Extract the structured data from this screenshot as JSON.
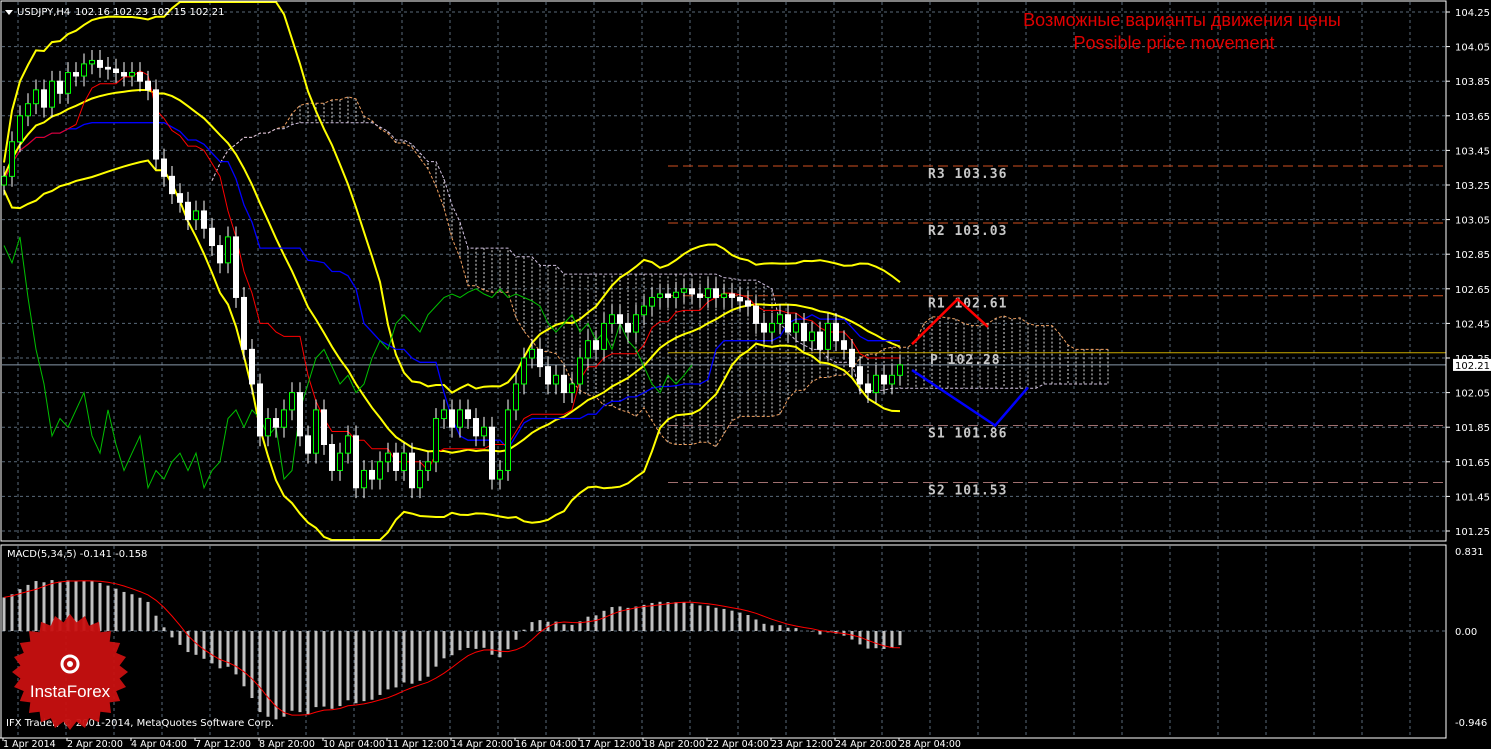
{
  "header": {
    "symbol": "USDJPY,H4",
    "ohlc": "102.16 102.23 102.15 102.21"
  },
  "title": {
    "ru": "Возможные варианты движения цены",
    "en": "Possible price movement"
  },
  "copyright": "IFX Trader, © 2001-2014, MetaQuotes Software Corp.",
  "logo": "InstaForex",
  "colors": {
    "bollinger": "#ffff00",
    "tenkan": "#ff0000",
    "kijun": "#0000ff",
    "chikou": "#00c000",
    "cloud": "#f0a060",
    "up_scenario": "#ff0000",
    "down_scenario": "#0000ff",
    "macd_hist": "#c0c0c0",
    "macd_signal": "#ff0000"
  },
  "chart_data": [
    {
      "type": "candlestick",
      "title": "USDJPY,H4",
      "ylim": [
        101.25,
        104.25
      ],
      "y_ticks": [
        "104.25",
        "104.05",
        "103.85",
        "103.65",
        "103.45",
        "103.25",
        "103.05",
        "102.85",
        "102.65",
        "102.45",
        "102.25",
        "102.05",
        "101.85",
        "101.65",
        "101.45",
        "101.25"
      ],
      "x_ticks": [
        "1 Apr 2014",
        "2 Apr 20:00",
        "4 Apr 04:00",
        "7 Apr 12:00",
        "8 Apr 20:00",
        "10 Apr 04:00",
        "11 Apr 12:00",
        "14 Apr 20:00",
        "16 Apr 04:00",
        "17 Apr 12:00",
        "18 Apr 20:00",
        "22 Apr 04:00",
        "23 Apr 12:00",
        "24 Apr 20:00",
        "28 Apr 04:00"
      ],
      "current_price": "102.21",
      "close": [
        103.3,
        103.5,
        103.65,
        103.72,
        103.8,
        103.7,
        103.85,
        103.78,
        103.9,
        103.88,
        103.95,
        103.97,
        103.93,
        103.92,
        103.9,
        103.88,
        103.9,
        103.85,
        103.8,
        103.4,
        103.3,
        103.2,
        103.15,
        103.05,
        103.1,
        103.0,
        102.9,
        102.8,
        102.95,
        102.6,
        102.3,
        102.1,
        101.8,
        101.9,
        101.85,
        101.95,
        102.05,
        101.8,
        101.7,
        101.95,
        101.75,
        101.6,
        101.7,
        101.8,
        101.5,
        101.6,
        101.55,
        101.65,
        101.7,
        101.6,
        101.7,
        101.5,
        101.6,
        101.65,
        101.9,
        101.95,
        101.85,
        101.95,
        101.9,
        101.8,
        101.85,
        101.55,
        101.6,
        101.95,
        102.1,
        102.25,
        102.3,
        102.2,
        102.1,
        102.15,
        102.05,
        102.1,
        102.25,
        102.35,
        102.3,
        102.45,
        102.5,
        102.45,
        102.4,
        102.5,
        102.55,
        102.6,
        102.62,
        102.6,
        102.63,
        102.65,
        102.62,
        102.6,
        102.65,
        102.6,
        102.62,
        102.6,
        102.58,
        102.55,
        102.45,
        102.4,
        102.45,
        102.5,
        102.4,
        102.45,
        102.35,
        102.4,
        102.3,
        102.45,
        102.35,
        102.3,
        102.2,
        102.1,
        102.05,
        102.15,
        102.1,
        102.15,
        102.21
      ],
      "pivots": [
        {
          "label": "R3 103.36",
          "value": 103.36,
          "color": "#d05020"
        },
        {
          "label": "R2 103.03",
          "value": 103.03,
          "color": "#d05020"
        },
        {
          "label": "R1 102.61",
          "value": 102.61,
          "color": "#d05020"
        },
        {
          "label": "P 102.28",
          "value": 102.28,
          "color": "#c8a800"
        },
        {
          "label": "S1 101.86",
          "value": 101.86,
          "color": "#a07070"
        },
        {
          "label": "S2 101.53",
          "value": 101.53,
          "color": "#a07070"
        }
      ],
      "scenarios": [
        {
          "name": "up",
          "points": [
            [
              113.5,
              102.33
            ],
            [
              119.2,
              102.59
            ],
            [
              123,
              102.43
            ]
          ]
        },
        {
          "name": "down",
          "points": [
            [
              113.5,
              102.18
            ],
            [
              123.9,
              101.86
            ],
            [
              128,
              102.08
            ]
          ]
        }
      ]
    },
    {
      "type": "bar",
      "title": "MACD(5,34,5) -0.141 -0.158",
      "ylim": [
        -0.946,
        0.831
      ],
      "y_ticks": [
        "0.831",
        "0.00",
        "-0.946"
      ],
      "params": [
        5,
        34,
        5
      ]
    }
  ]
}
